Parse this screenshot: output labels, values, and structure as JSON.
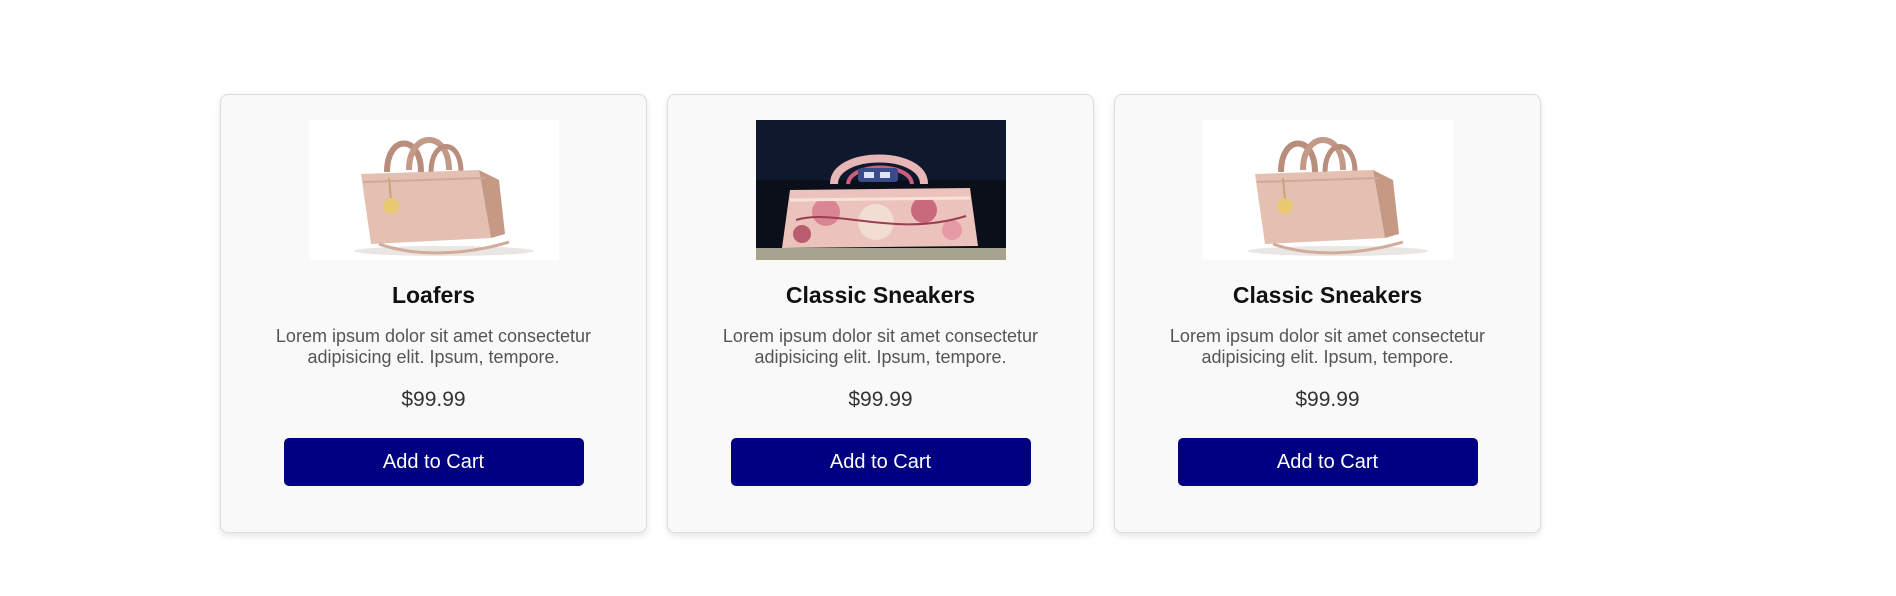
{
  "products": [
    {
      "title": "Loafers",
      "description": "Lorem ipsum dolor sit amet consectetur adipisicing elit. Ipsum, tempore.",
      "price": "$99.99",
      "button_label": "Add to Cart",
      "image_icon": "beige-handbag-image"
    },
    {
      "title": "Classic Sneakers",
      "description": "Lorem ipsum dolor sit amet consectetur adipisicing elit. Ipsum, tempore.",
      "price": "$99.99",
      "button_label": "Add to Cart",
      "image_icon": "floral-handbag-image"
    },
    {
      "title": "Classic Sneakers",
      "description": "Lorem ipsum dolor sit amet consectetur adipisicing elit. Ipsum, tempore.",
      "price": "$99.99",
      "button_label": "Add to Cart",
      "image_icon": "beige-handbag-image"
    }
  ],
  "colors": {
    "button_bg": "#000080",
    "button_text": "#ffffff",
    "card_bg": "#f9f9f9"
  }
}
